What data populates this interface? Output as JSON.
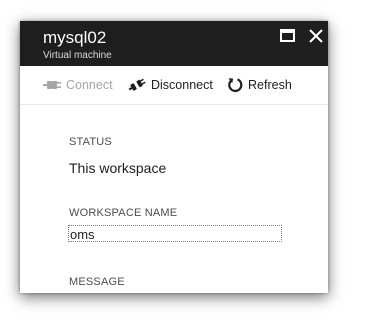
{
  "header": {
    "title": "mysql02",
    "subtitle": "Virtual machine"
  },
  "toolbar": {
    "connect_label": "Connect",
    "disconnect_label": "Disconnect",
    "refresh_label": "Refresh"
  },
  "fields": {
    "status_label": "STATUS",
    "status_value": "This workspace",
    "workspace_label": "WORKSPACE NAME",
    "workspace_value": "oms",
    "message_label": "MESSAGE"
  },
  "colors": {
    "header_bg": "#1e1e1e",
    "disabled_text": "#a6a6a6",
    "focus_border": "#2a8fd6"
  },
  "icons": {
    "maximize": "maximize-icon",
    "close": "close-icon",
    "connect": "plug-connect-icon",
    "disconnect": "plug-disconnect-icon",
    "refresh": "refresh-icon"
  }
}
